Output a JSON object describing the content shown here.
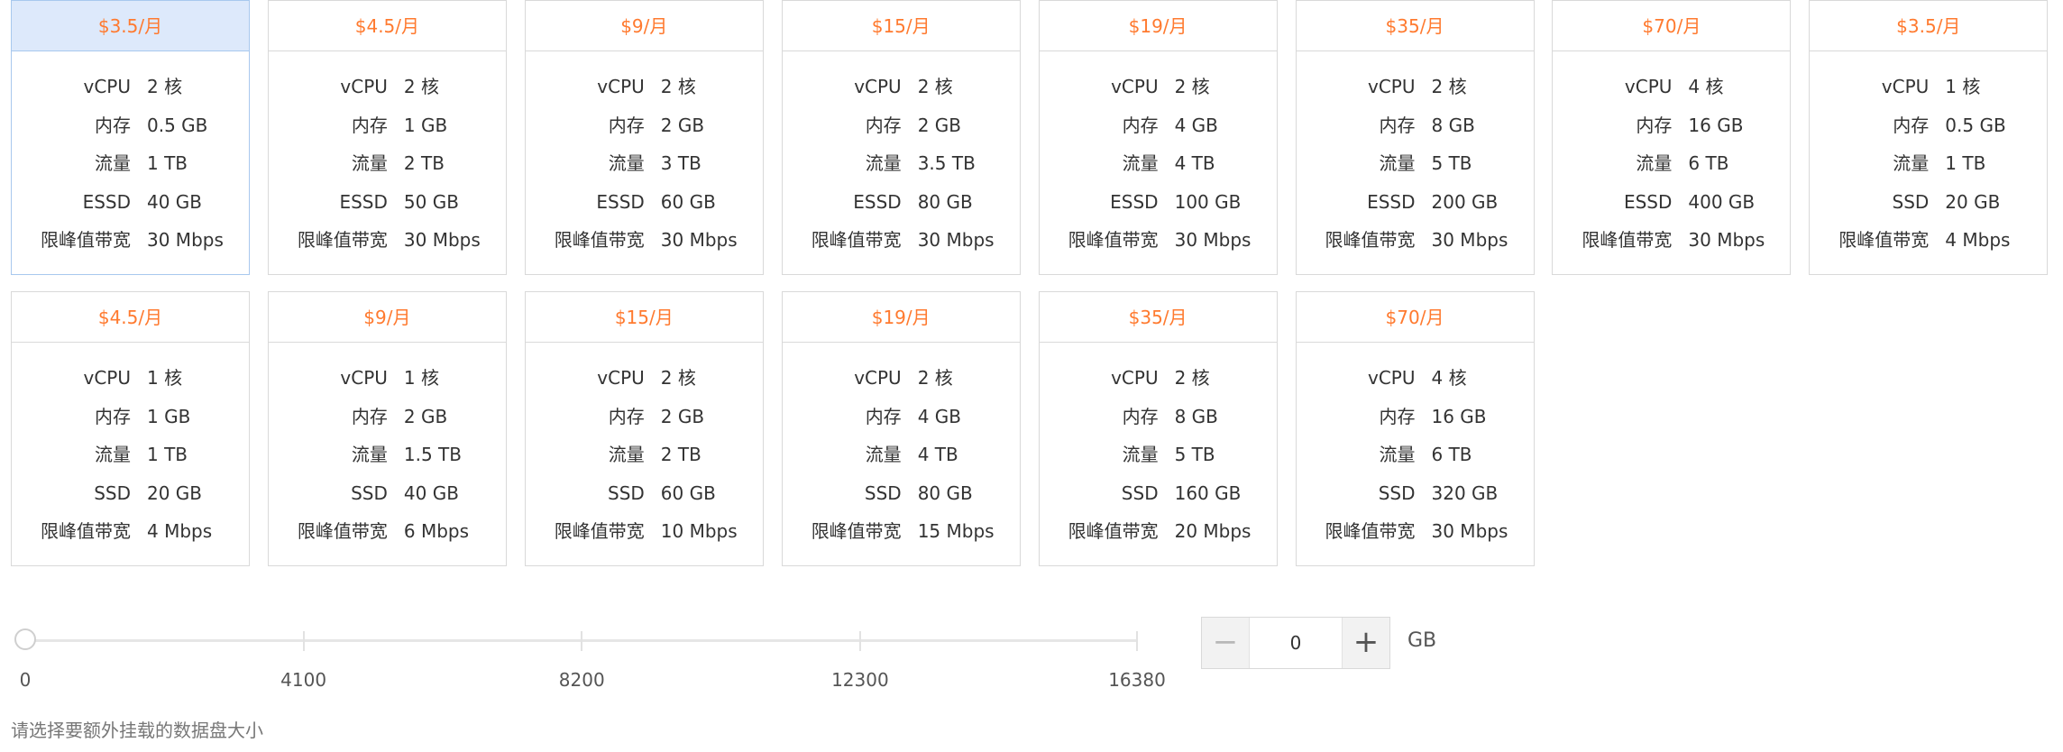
{
  "plans": [
    {
      "price": "$3.5/月",
      "selected": true,
      "specs": [
        [
          "vCPU",
          "2 核"
        ],
        [
          "内存",
          "0.5 GB"
        ],
        [
          "流量",
          "1 TB"
        ],
        [
          "ESSD",
          "40 GB"
        ],
        [
          "限峰值带宽",
          "30 Mbps"
        ]
      ]
    },
    {
      "price": "$4.5/月",
      "selected": false,
      "specs": [
        [
          "vCPU",
          "2 核"
        ],
        [
          "内存",
          "1 GB"
        ],
        [
          "流量",
          "2 TB"
        ],
        [
          "ESSD",
          "50 GB"
        ],
        [
          "限峰值带宽",
          "30 Mbps"
        ]
      ]
    },
    {
      "price": "$9/月",
      "selected": false,
      "specs": [
        [
          "vCPU",
          "2 核"
        ],
        [
          "内存",
          "2 GB"
        ],
        [
          "流量",
          "3 TB"
        ],
        [
          "ESSD",
          "60 GB"
        ],
        [
          "限峰值带宽",
          "30 Mbps"
        ]
      ]
    },
    {
      "price": "$15/月",
      "selected": false,
      "specs": [
        [
          "vCPU",
          "2 核"
        ],
        [
          "内存",
          "2 GB"
        ],
        [
          "流量",
          "3.5 TB"
        ],
        [
          "ESSD",
          "80 GB"
        ],
        [
          "限峰值带宽",
          "30 Mbps"
        ]
      ]
    },
    {
      "price": "$19/月",
      "selected": false,
      "specs": [
        [
          "vCPU",
          "2 核"
        ],
        [
          "内存",
          "4 GB"
        ],
        [
          "流量",
          "4 TB"
        ],
        [
          "ESSD",
          "100 GB"
        ],
        [
          "限峰值带宽",
          "30 Mbps"
        ]
      ]
    },
    {
      "price": "$35/月",
      "selected": false,
      "specs": [
        [
          "vCPU",
          "2 核"
        ],
        [
          "内存",
          "8 GB"
        ],
        [
          "流量",
          "5 TB"
        ],
        [
          "ESSD",
          "200 GB"
        ],
        [
          "限峰值带宽",
          "30 Mbps"
        ]
      ]
    },
    {
      "price": "$70/月",
      "selected": false,
      "specs": [
        [
          "vCPU",
          "4 核"
        ],
        [
          "内存",
          "16 GB"
        ],
        [
          "流量",
          "6 TB"
        ],
        [
          "ESSD",
          "400 GB"
        ],
        [
          "限峰值带宽",
          "30 Mbps"
        ]
      ]
    },
    {
      "price": "$3.5/月",
      "selected": false,
      "specs": [
        [
          "vCPU",
          "1 核"
        ],
        [
          "内存",
          "0.5 GB"
        ],
        [
          "流量",
          "1 TB"
        ],
        [
          "SSD",
          "20 GB"
        ],
        [
          "限峰值带宽",
          "4 Mbps"
        ]
      ]
    },
    {
      "price": "$4.5/月",
      "selected": false,
      "specs": [
        [
          "vCPU",
          "1 核"
        ],
        [
          "内存",
          "1 GB"
        ],
        [
          "流量",
          "1 TB"
        ],
        [
          "SSD",
          "20 GB"
        ],
        [
          "限峰值带宽",
          "4 Mbps"
        ]
      ]
    },
    {
      "price": "$9/月",
      "selected": false,
      "specs": [
        [
          "vCPU",
          "1 核"
        ],
        [
          "内存",
          "2 GB"
        ],
        [
          "流量",
          "1.5 TB"
        ],
        [
          "SSD",
          "40 GB"
        ],
        [
          "限峰值带宽",
          "6 Mbps"
        ]
      ]
    },
    {
      "price": "$15/月",
      "selected": false,
      "specs": [
        [
          "vCPU",
          "2 核"
        ],
        [
          "内存",
          "2 GB"
        ],
        [
          "流量",
          "2 TB"
        ],
        [
          "SSD",
          "60 GB"
        ],
        [
          "限峰值带宽",
          "10 Mbps"
        ]
      ]
    },
    {
      "price": "$19/月",
      "selected": false,
      "specs": [
        [
          "vCPU",
          "2 核"
        ],
        [
          "内存",
          "4 GB"
        ],
        [
          "流量",
          "4 TB"
        ],
        [
          "SSD",
          "80 GB"
        ],
        [
          "限峰值带宽",
          "15 Mbps"
        ]
      ]
    },
    {
      "price": "$35/月",
      "selected": false,
      "specs": [
        [
          "vCPU",
          "2 核"
        ],
        [
          "内存",
          "8 GB"
        ],
        [
          "流量",
          "5 TB"
        ],
        [
          "SSD",
          "160 GB"
        ],
        [
          "限峰值带宽",
          "20 Mbps"
        ]
      ]
    },
    {
      "price": "$70/月",
      "selected": false,
      "specs": [
        [
          "vCPU",
          "4 核"
        ],
        [
          "内存",
          "16 GB"
        ],
        [
          "流量",
          "6 TB"
        ],
        [
          "SSD",
          "320 GB"
        ],
        [
          "限峰值带宽",
          "30 Mbps"
        ]
      ]
    }
  ],
  "data_disk": {
    "slider_min": 0,
    "slider_max": 16380,
    "slider_value": 0,
    "slider_labels": [
      "0",
      "4100",
      "8200",
      "12300",
      "16380"
    ],
    "stepper_value": "0",
    "minus_label": "−",
    "plus_label": "+",
    "unit": "GB",
    "hint": "请选择要额外挂载的数据盘大小"
  },
  "colors": {
    "price": "#ff7a2f",
    "selected_header_bg": "#dde9fb",
    "selected_border": "#a8c8ee",
    "card_border": "#d9d9d9"
  }
}
